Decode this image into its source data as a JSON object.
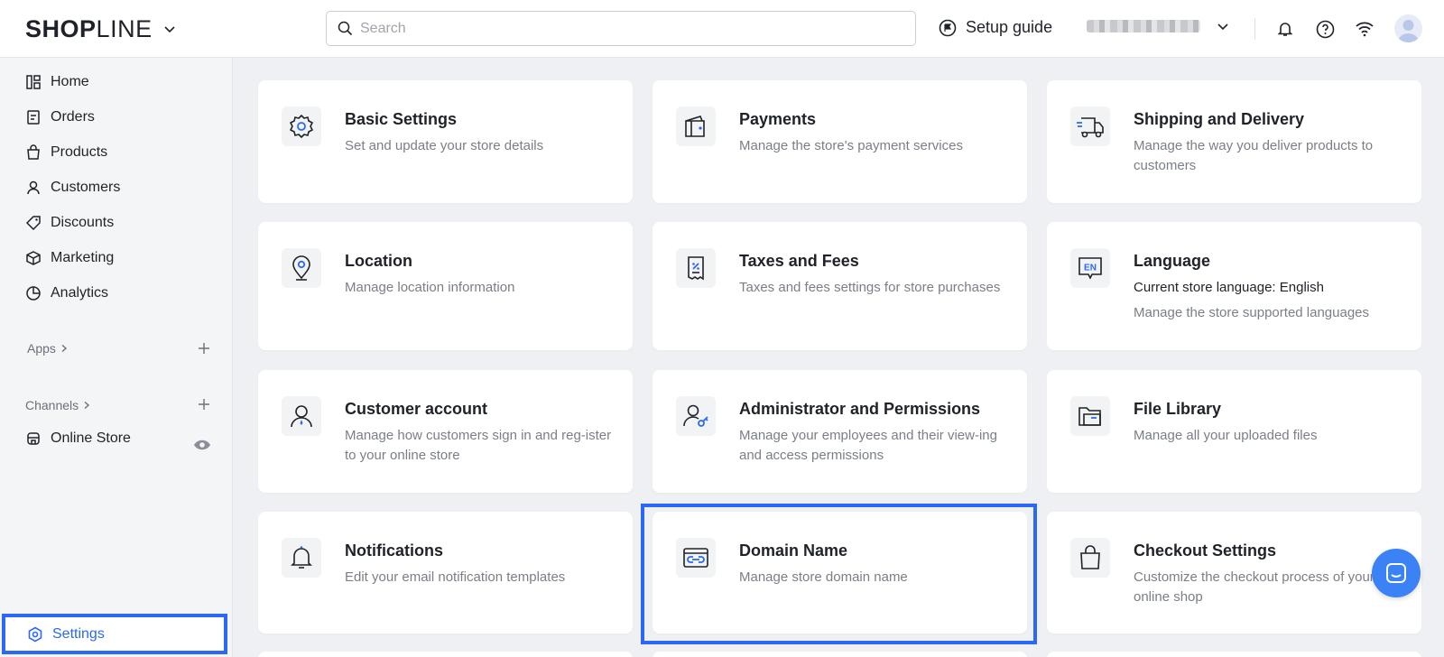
{
  "header": {
    "logo_bold": "SH",
    "logo_o": "O",
    "logo_p": "P",
    "logo_thin": "LINE",
    "search_placeholder": "Search",
    "setup_guide": "Setup guide"
  },
  "sidebar": {
    "items": [
      {
        "label": "Home",
        "icon": "home-icon"
      },
      {
        "label": "Orders",
        "icon": "orders-icon"
      },
      {
        "label": "Products",
        "icon": "products-icon"
      },
      {
        "label": "Customers",
        "icon": "customers-icon"
      },
      {
        "label": "Discounts",
        "icon": "discounts-icon"
      },
      {
        "label": "Marketing",
        "icon": "marketing-icon"
      },
      {
        "label": "Analytics",
        "icon": "analytics-icon"
      }
    ],
    "apps_label": "Apps",
    "channels_label": "Channels",
    "online_store": "Online Store",
    "settings": "Settings"
  },
  "cards": [
    {
      "title": "Basic Settings",
      "desc": "Set and update your store details",
      "icon": "gear-icon"
    },
    {
      "title": "Payments",
      "desc": "Manage the store's payment services",
      "icon": "wallet-icon"
    },
    {
      "title": "Shipping and Delivery",
      "desc": "Manage the way you deliver products to customers",
      "icon": "truck-icon"
    },
    {
      "title": "Location",
      "desc": "Manage location information",
      "icon": "location-pin-icon"
    },
    {
      "title": "Taxes and Fees",
      "desc": "Taxes and fees settings for store purchases",
      "icon": "receipt-percent-icon"
    },
    {
      "title": "Language",
      "desc": "Current store language: English",
      "desc2": "Manage the store supported languages",
      "icon": "language-en-icon"
    },
    {
      "title": "Customer account",
      "desc": "Manage how customers sign in and reg-ister to your online store",
      "icon": "user-icon"
    },
    {
      "title": "Administrator and Permissions",
      "desc": "Manage your employees and their view-ing and access permissions",
      "icon": "user-key-icon"
    },
    {
      "title": "File Library",
      "desc": "Manage all your uploaded files",
      "icon": "folder-icon"
    },
    {
      "title": "Notifications",
      "desc": "Edit your email notification templates",
      "icon": "bell-icon"
    },
    {
      "title": "Domain Name",
      "desc": "Manage store domain name",
      "icon": "domain-link-icon"
    },
    {
      "title": "Checkout Settings",
      "desc": "Customize the checkout process of your online shop",
      "icon": "shopping-bag-icon"
    }
  ],
  "colors": {
    "accent": "#2a68f5",
    "icon_blue": "#2a68f5",
    "text": "#1f2329"
  }
}
